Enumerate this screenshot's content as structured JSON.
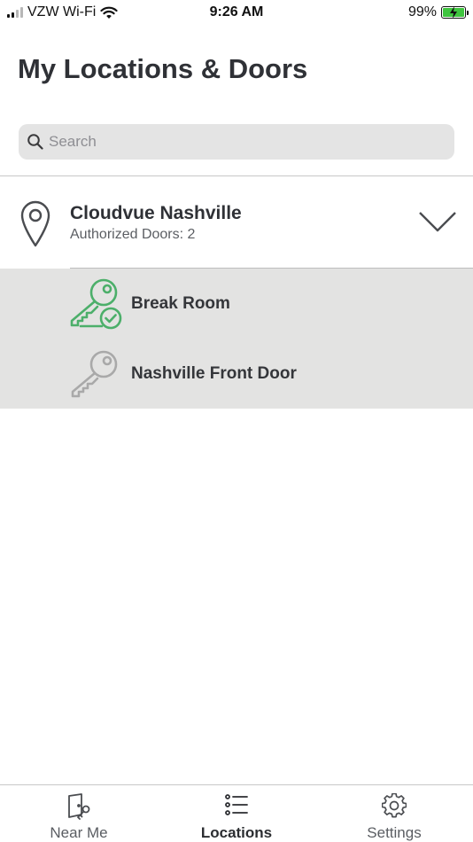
{
  "status_bar": {
    "carrier": "VZW Wi-Fi",
    "time": "9:26 AM",
    "battery": "99%"
  },
  "page": {
    "title": "My Locations & Doors"
  },
  "search": {
    "placeholder": "Search",
    "value": ""
  },
  "location": {
    "name": "Cloudvue Nashville",
    "authorized": "Authorized Doors: 2",
    "doors": [
      {
        "label": "Break Room",
        "icon": "key-check-icon",
        "color": "#4caf6a"
      },
      {
        "label": "Nashville Front Door",
        "icon": "key-icon",
        "color": "#a9a9a9"
      }
    ]
  },
  "tabs": [
    {
      "label": "Near Me",
      "icon": "door-key-icon",
      "active": false
    },
    {
      "label": "Locations",
      "icon": "list-icon",
      "active": true
    },
    {
      "label": "Settings",
      "icon": "gear-icon",
      "active": false
    }
  ]
}
